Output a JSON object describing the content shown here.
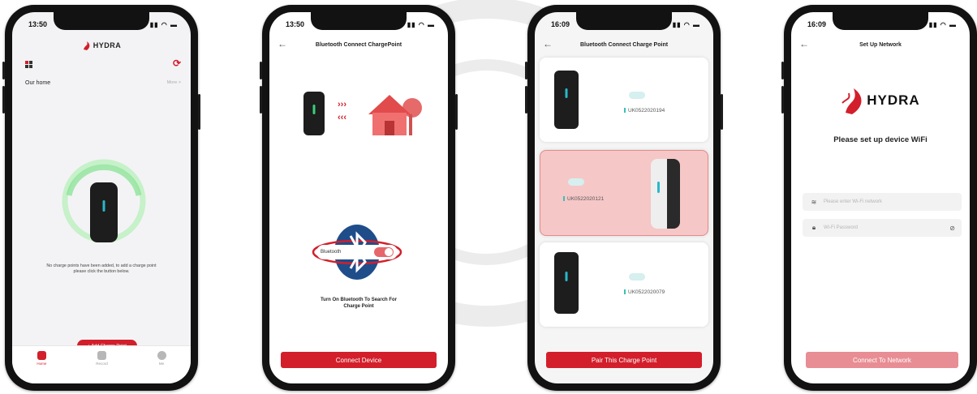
{
  "brand": {
    "name": "HYDRA",
    "accent": "#d21f2b"
  },
  "phone1": {
    "time": "13:50",
    "home_title": "Our home",
    "more_link": "More >",
    "empty_message": "No charge points have been added, to add a charge point please click the button below.",
    "add_button": "+ Add Charge Point",
    "tabs": [
      {
        "label": "Home",
        "icon": "home-icon"
      },
      {
        "label": "Record",
        "icon": "record-icon"
      },
      {
        "label": "Me",
        "icon": "user-icon"
      }
    ]
  },
  "phone2": {
    "time": "13:50",
    "title": "Bluetooth Connect ChargePoint",
    "bluetooth_label": "Bluetooth",
    "instruction": "Turn On Bluetooth To Search For Charge Point",
    "connect_button": "Connect Device"
  },
  "phone3": {
    "time": "16:09",
    "title": "Bluetooth Connect Charge Point",
    "devices": [
      {
        "serial": "UK0522020194",
        "selected": false
      },
      {
        "serial": "UK0522020121",
        "selected": true
      },
      {
        "serial": "UK0522020079",
        "selected": false
      }
    ],
    "pair_button": "Pair This Charge Point"
  },
  "phone4": {
    "time": "16:09",
    "title": "Set Up Network",
    "heading": "Please set up device WiFi",
    "network_placeholder": "Please enter Wi-Fi network",
    "password_placeholder": "Wi-Fi Password",
    "connect_button": "Connect To Network"
  }
}
